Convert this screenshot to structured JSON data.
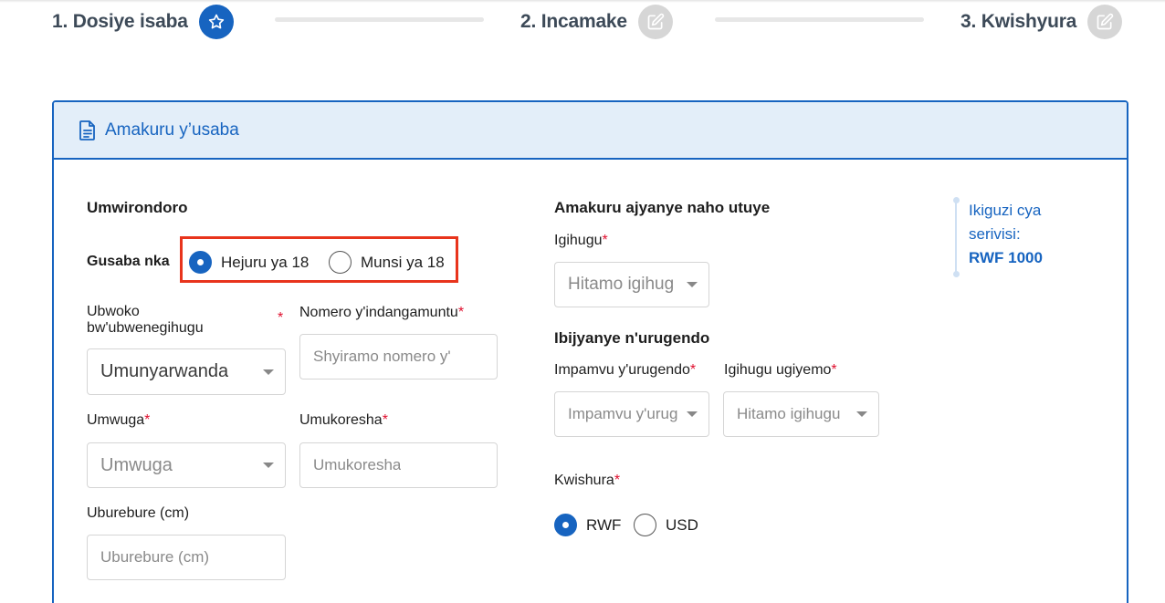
{
  "stepper": {
    "steps": [
      {
        "label": "1. Dosiye isaba",
        "icon": "star-icon",
        "state": "active"
      },
      {
        "label": "2. Incamake",
        "icon": "edit-icon",
        "state": "inactive"
      },
      {
        "label": "3. Kwishyura",
        "icon": "edit-icon",
        "state": "inactive"
      }
    ]
  },
  "card": {
    "title": "Amakuru y’usaba",
    "icon": "document-icon"
  },
  "profile": {
    "title": "Umwirondoro",
    "age_label": "Gusaba nka",
    "age_options": [
      "Hejuru ya 18",
      "Munsi ya 18"
    ],
    "age_selected": "Hejuru ya 18",
    "nationality_label": "Ubwoko bw'ubwenegihugu",
    "nationality_value": "Umunyarwanda",
    "id_label": "Nomero y'indangamuntu",
    "id_placeholder": "Shyiramo nomero y'",
    "gender_label": "Umwuga",
    "gender_placeholder": "Umwuga",
    "employer_label": "Umukoresha",
    "employer_placeholder": "Umukoresha",
    "height_label": "Uburebure (cm)",
    "height_placeholder": "Uburebure (cm)",
    "required_mark": "*"
  },
  "residence": {
    "title": "Amakuru ajyanye naho utuye",
    "country_label": "Igihugu",
    "country_placeholder": "Hitamo igihug"
  },
  "travel": {
    "title": "Ibijyanye n'urugendo",
    "purpose_label": "Impamvu y'urugendo",
    "purpose_placeholder": "Impamvu y'urug",
    "dest_label": "Igihugu ugiyemo",
    "dest_placeholder": "Hitamo igihugu"
  },
  "payment": {
    "label": "Kwishura",
    "options": [
      "RWF",
      "USD"
    ],
    "selected": "RWF"
  },
  "price": {
    "line1": "Ikiguzi cya",
    "line2": "serivisi:",
    "amount": "RWF 1000"
  },
  "colors": {
    "accent": "#1764c0",
    "highlight": "#e8341c",
    "required": "#e0102f"
  }
}
